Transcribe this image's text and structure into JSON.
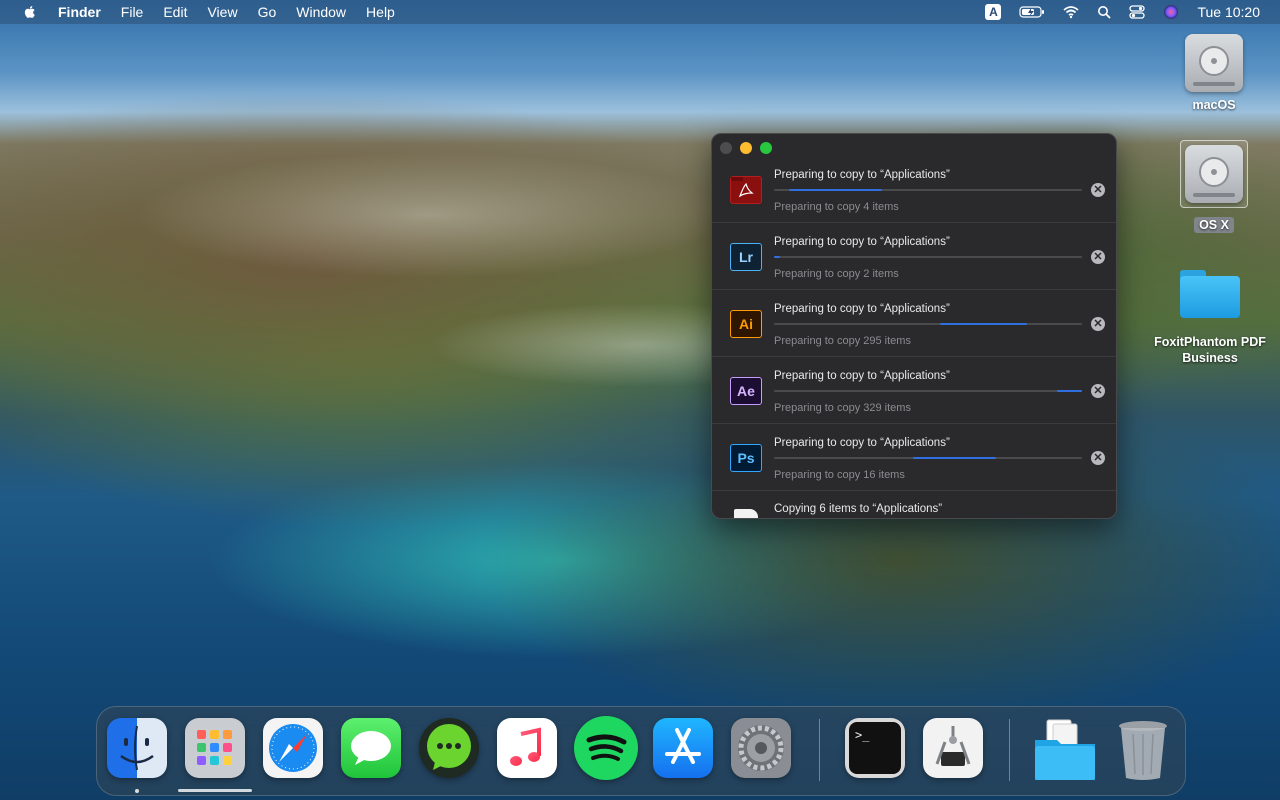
{
  "menubar": {
    "apple_icon": "apple-logo-icon",
    "app_name": "Finder",
    "menus": [
      "File",
      "Edit",
      "View",
      "Go",
      "Window",
      "Help"
    ],
    "input_source": "A",
    "status_icons": [
      "battery-charging-icon",
      "wifi-icon",
      "spotlight-search-icon",
      "control-center-icon",
      "siri-icon"
    ],
    "clock": "Tue 10:20"
  },
  "desktop": {
    "items": [
      {
        "label": "macOS",
        "icon": "hard-drive-icon",
        "selected": false
      },
      {
        "label": "OS X",
        "icon": "hard-drive-icon",
        "selected": true
      },
      {
        "label": "FoxitPhantom PDF Business",
        "icon": "folder-icon",
        "selected": false
      }
    ]
  },
  "copy_window": {
    "buttons": {
      "close_color": "#4d4d4f",
      "minimize_color": "#febc2e",
      "zoom_color": "#28c840"
    },
    "accent_color": "#2f6fe0",
    "cancel_glyph": "✕",
    "operations": [
      {
        "title": "Preparing to copy to “Applications”",
        "status": "Preparing to copy 4 items",
        "app_icon": "acrobat-icon",
        "icon_text": "",
        "icon_color": "#8a0f0f",
        "progress_start": 0.05,
        "progress_end": 0.35
      },
      {
        "title": "Preparing to copy to “Applications”",
        "status": "Preparing to copy 2 items",
        "app_icon": "lightroom-icon",
        "icon_text": "Lr",
        "icon_color": "#0f2233",
        "progress_start": 0.0,
        "progress_end": 0.02
      },
      {
        "title": "Preparing to copy to “Applications”",
        "status": "Preparing to copy 295 items",
        "app_icon": "illustrator-icon",
        "icon_text": "Ai",
        "icon_color": "#2f1600",
        "progress_start": 0.54,
        "progress_end": 0.82
      },
      {
        "title": "Preparing to copy to “Applications”",
        "status": "Preparing to copy 329 items",
        "app_icon": "after-effects-icon",
        "icon_text": "Ae",
        "icon_color": "#1c0e33",
        "progress_start": 0.92,
        "progress_end": 1.0
      },
      {
        "title": "Preparing to copy to “Applications”",
        "status": "Preparing to copy 16 items",
        "app_icon": "photoshop-icon",
        "icon_text": "Ps",
        "icon_color": "#001b33",
        "progress_start": 0.45,
        "progress_end": 0.72
      },
      {
        "title": "Copying 6 items to “Applications”",
        "status": "",
        "app_icon": "document-icon",
        "icon_text": "",
        "icon_color": "#f2f2f2",
        "progress_start": 0.0,
        "progress_end": 0.0
      }
    ]
  },
  "dock": {
    "apps": [
      {
        "name": "finder-icon",
        "running": true
      },
      {
        "name": "launchpad-icon",
        "running": false
      },
      {
        "name": "safari-icon",
        "running": false
      },
      {
        "name": "messages-icon",
        "running": false
      },
      {
        "name": "chat-app-icon",
        "running": false
      },
      {
        "name": "music-icon",
        "running": false
      },
      {
        "name": "spotify-icon",
        "running": false
      },
      {
        "name": "app-store-icon",
        "running": false
      },
      {
        "name": "system-preferences-icon",
        "running": false
      },
      {
        "name": "terminal-icon",
        "running": false
      },
      {
        "name": "system-information-icon",
        "running": false
      },
      {
        "name": "applications-folder-icon",
        "running": false
      },
      {
        "name": "trash-icon",
        "running": false
      }
    ],
    "terminal_prompt": ">_"
  }
}
